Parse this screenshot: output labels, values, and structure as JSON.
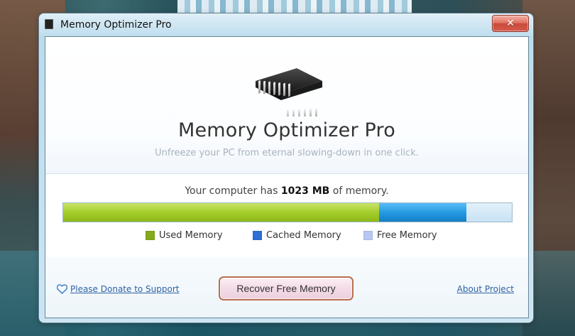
{
  "window": {
    "title": "Memory Optimizer Pro",
    "close_icon": "✕"
  },
  "hero": {
    "title": "Memory Optimizer Pro",
    "subtitle": "Unfreeze your PC from eternal slowing-down in one click.",
    "icon_name": "memory-chip-icon"
  },
  "memory": {
    "summary_prefix": "Your computer has ",
    "amount": "1023 MB",
    "summary_suffix": " of memory.",
    "distribution": {
      "used": 0.704,
      "cached": 0.195,
      "free": 0.101
    },
    "legend": [
      {
        "label": "Used Memory",
        "color": "#84a91a"
      },
      {
        "label": "Cached Memory",
        "color": "#2f6fd6"
      },
      {
        "label": "Free Memory",
        "color": "#b7c8f1"
      }
    ]
  },
  "footer": {
    "donate_label": "Please Donate to Support",
    "recover_label": "Recover Free Memory",
    "about_label": "About Project",
    "heart_icon": "heart-icon"
  },
  "colors": {
    "accent_blue": "#2e63a5",
    "used_green": "#a7cf2f",
    "cached_blue": "#2297e0",
    "free_blue": "#d3e7f6",
    "button_border": "#b86f4f"
  }
}
